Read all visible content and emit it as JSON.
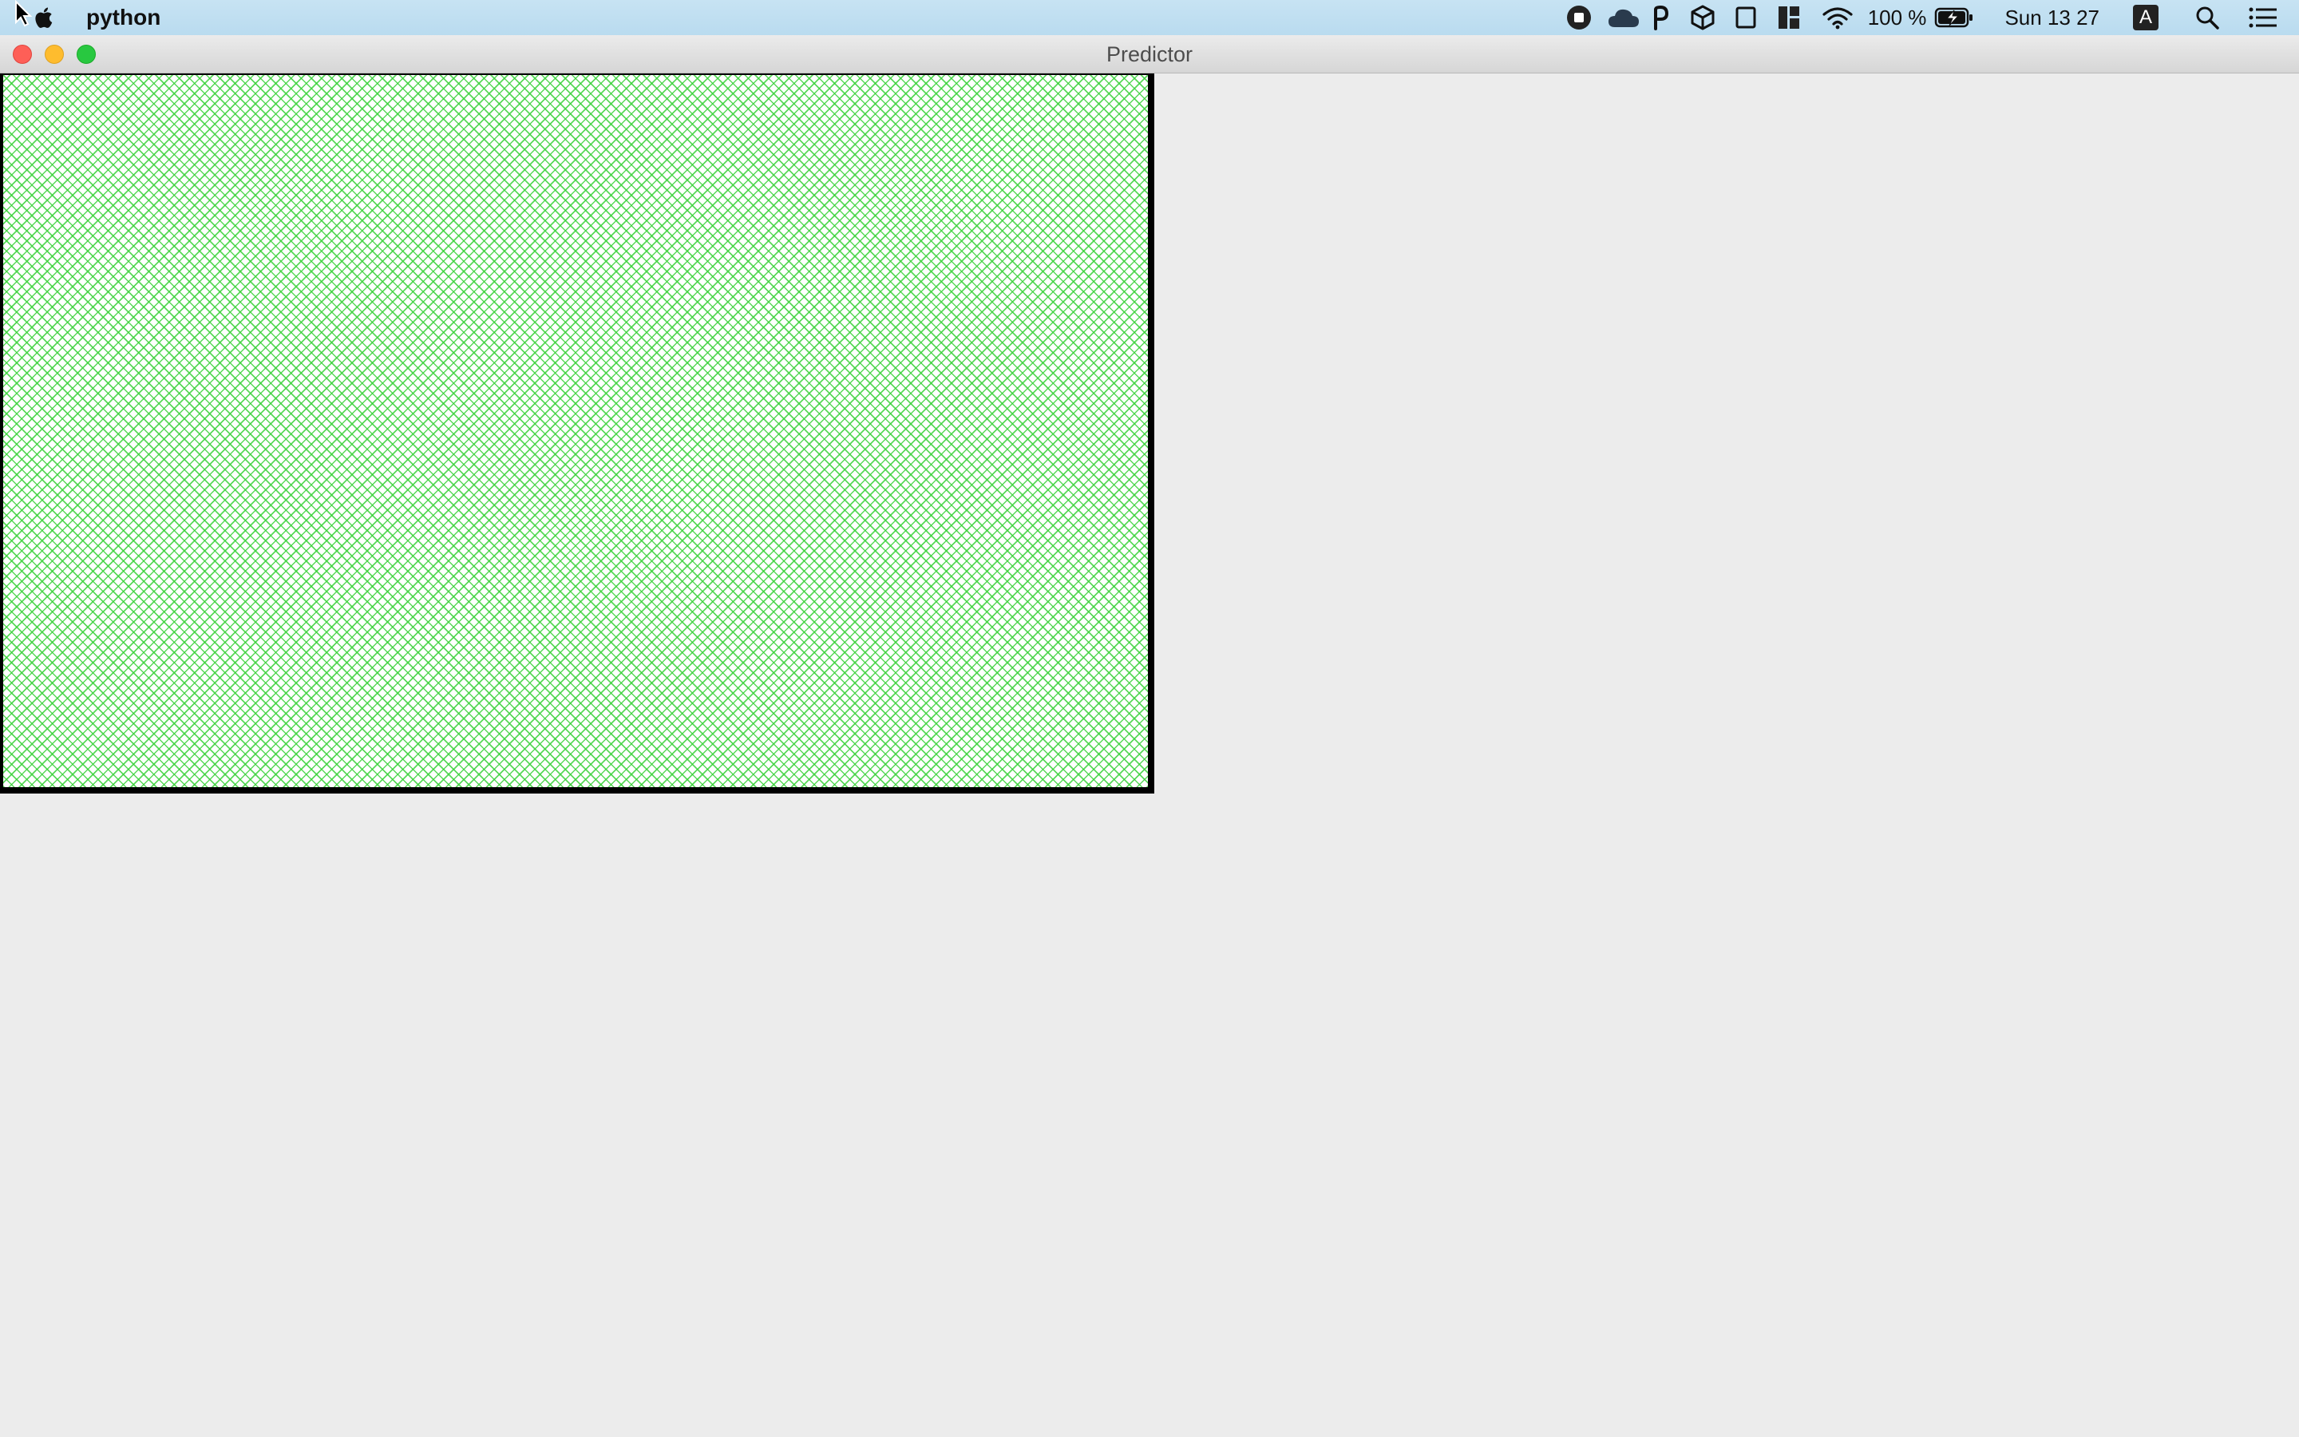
{
  "menubar": {
    "app_name": "python",
    "battery_text": "100 %",
    "clock": "Sun 13 27",
    "input_source": "A",
    "status_icons": [
      "record-icon",
      "cloud-icon",
      "p-icon",
      "box-icon",
      "square-icon",
      "layout-icon",
      "wifi-icon",
      "battery-icon",
      "input-source-icon",
      "search-icon",
      "list-icon"
    ]
  },
  "window": {
    "title": "Predictor",
    "canvas_pattern": "green-crosshatch",
    "colors": {
      "canvas_hatch": "#3cd23c",
      "canvas_border": "#000000",
      "background": "#ececec"
    }
  }
}
